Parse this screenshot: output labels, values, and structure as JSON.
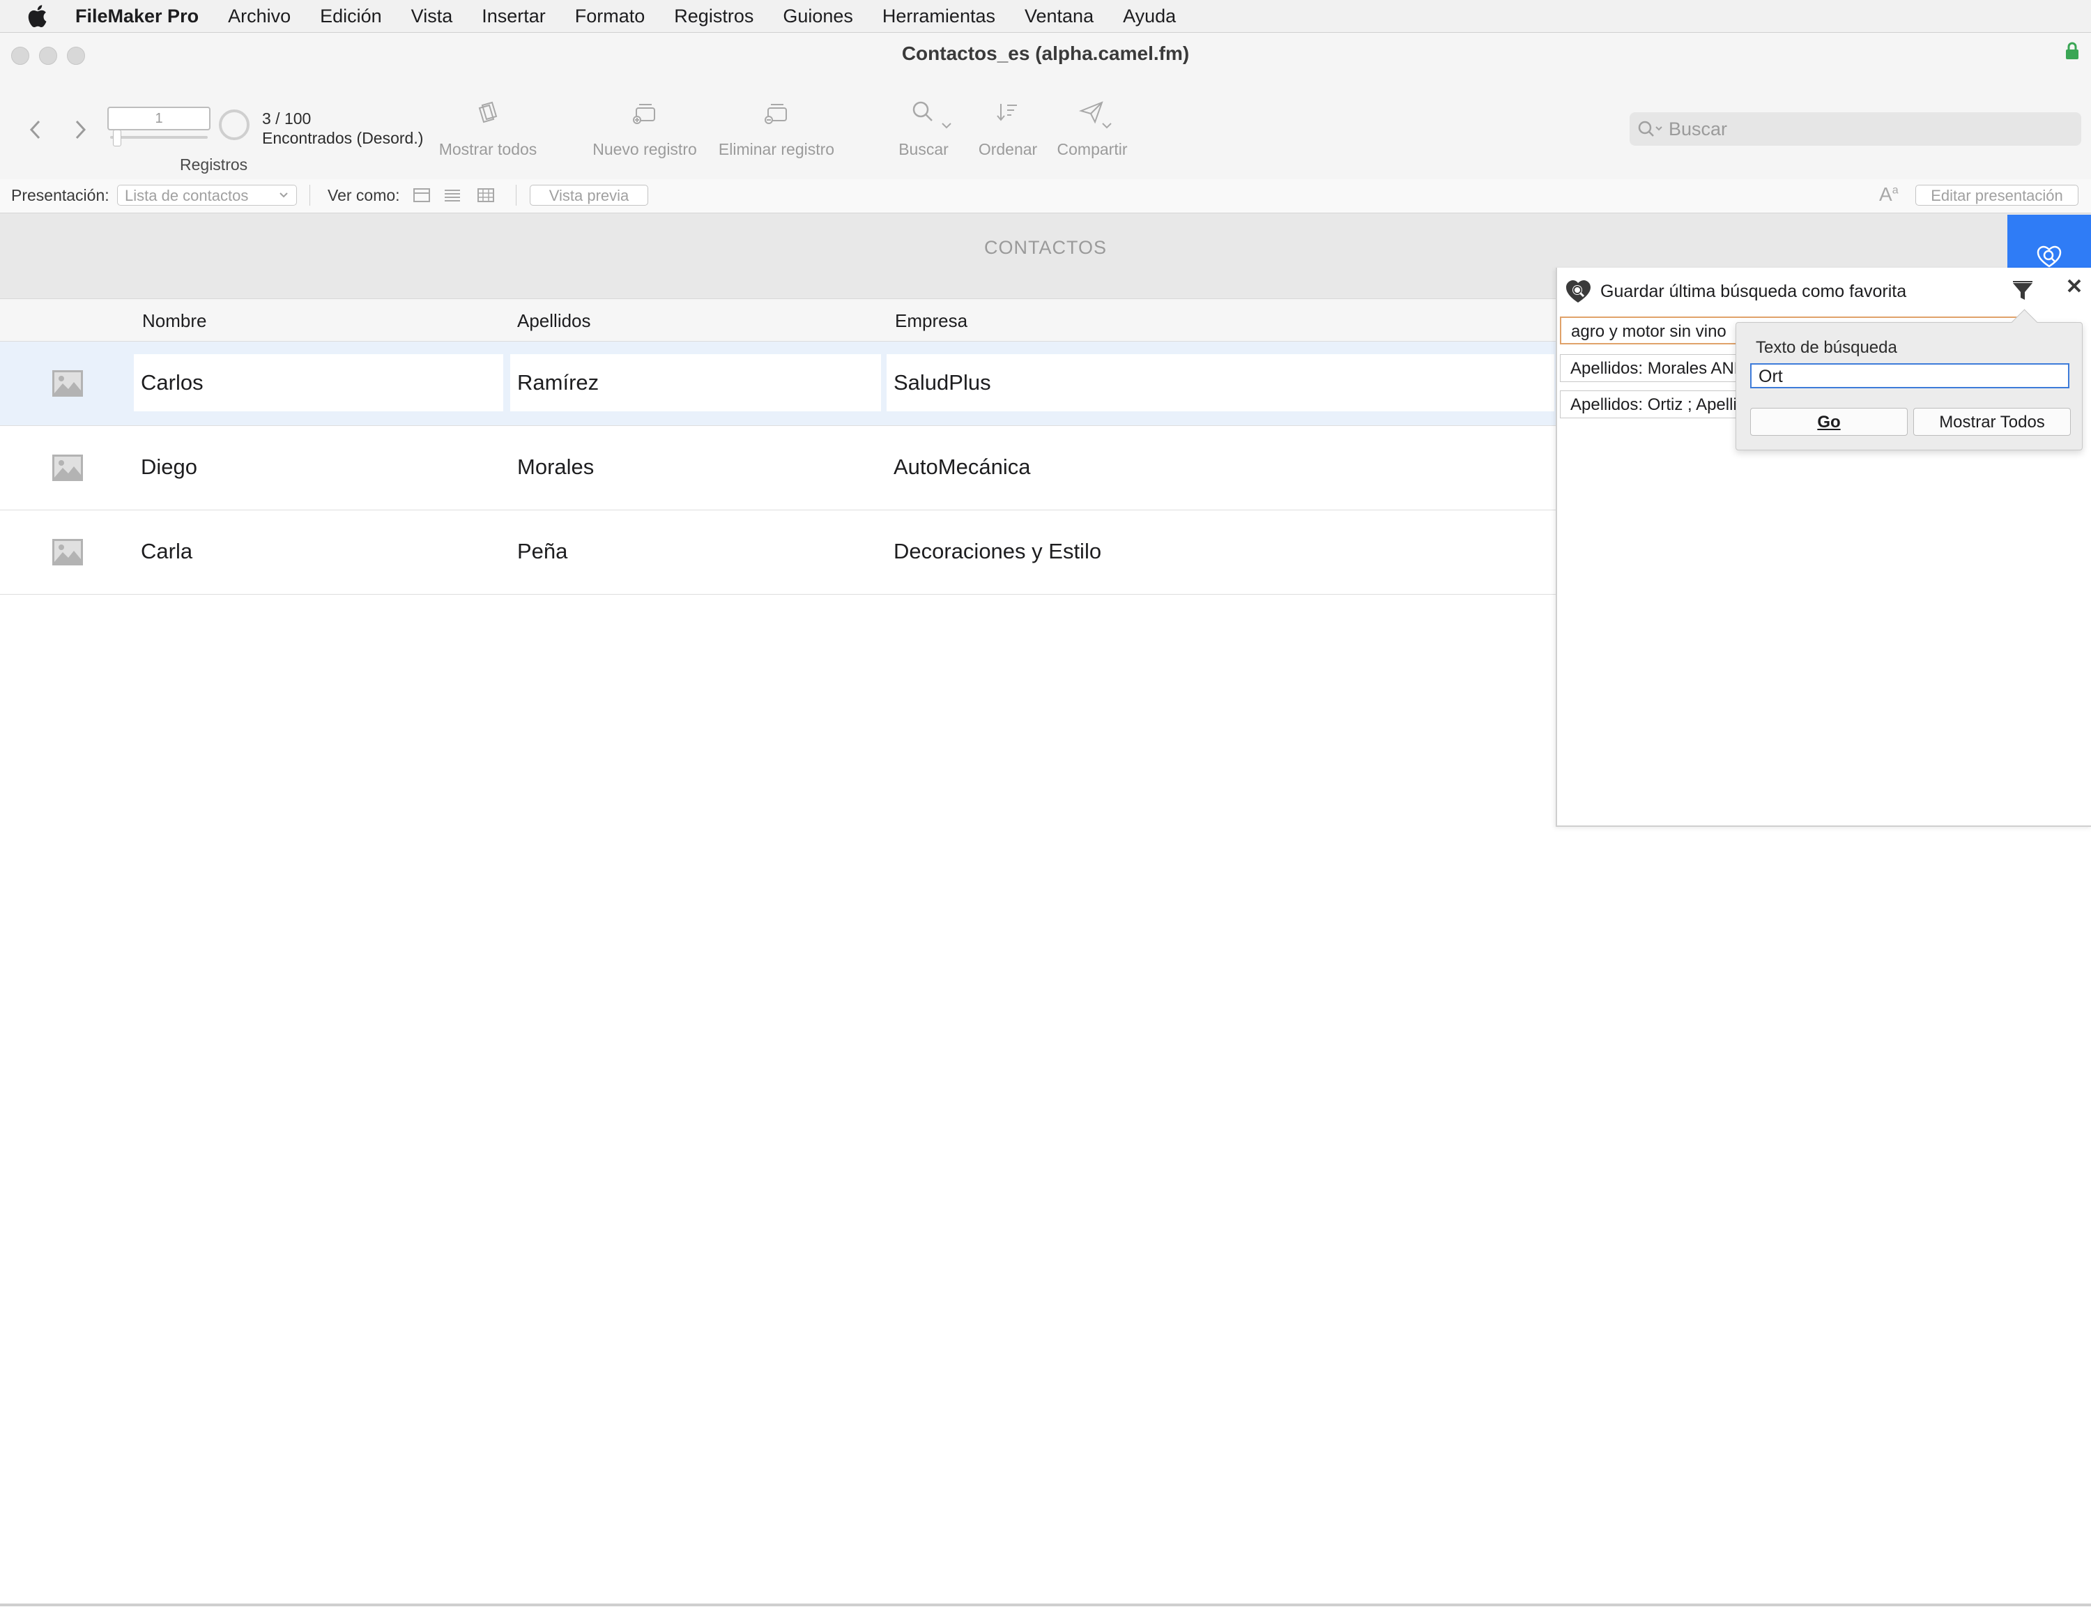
{
  "menubar": {
    "app": "FileMaker Pro",
    "items": [
      "Archivo",
      "Edición",
      "Vista",
      "Insertar",
      "Formato",
      "Registros",
      "Guiones",
      "Herramientas",
      "Ventana",
      "Ayuda"
    ]
  },
  "window": {
    "title": "Contactos_es (alpha.camel.fm)"
  },
  "toolbar": {
    "record_number": "1",
    "found_count": "3 / 100",
    "found_label": "Encontrados (Desord.)",
    "records_label": "Registros",
    "show_all": "Mostrar todos",
    "new_record": "Nuevo registro",
    "delete_record": "Eliminar registro",
    "find": "Buscar",
    "sort": "Ordenar",
    "share": "Compartir",
    "search_placeholder": "Buscar"
  },
  "layoutbar": {
    "layout_label": "Presentación:",
    "layout_value": "Lista de contactos",
    "view_as_label": "Ver como:",
    "preview": "Vista previa",
    "edit_layout": "Editar presentación"
  },
  "layout": {
    "header_title": "CONTACTOS",
    "columns": [
      "Nombre",
      "Apellidos",
      "Empresa"
    ],
    "rows": [
      {
        "nombre": "Carlos",
        "apellidos": "Ramírez",
        "empresa": "SaludPlus"
      },
      {
        "nombre": "Diego",
        "apellidos": "Morales",
        "empresa": "AutoMecánica"
      },
      {
        "nombre": "Carla",
        "apellidos": "Peña",
        "empresa": "Decoraciones y Estilo"
      }
    ]
  },
  "favorites": {
    "title": "Guardar última búsqueda como favorita",
    "items": [
      "agro y motor sin vino",
      "Apellidos: Morales AND",
      "Apellidos: Ortiz ; Apelli"
    ],
    "popover": {
      "label": "Texto de búsqueda",
      "value": "Ort",
      "go": "Go",
      "show_all": "Mostrar Todos"
    }
  },
  "colors": {
    "accent": "#2f7cf6",
    "selected_row": "#e9f1fb",
    "active_item_border": "#e0a26a",
    "input_focus": "#3d7bd9"
  }
}
